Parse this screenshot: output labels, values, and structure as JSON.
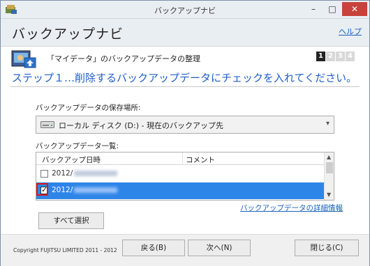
{
  "window": {
    "title": "バックアップナビ",
    "minimize_glyph": "–",
    "maximize_glyph": "□",
    "close_glyph": "✕"
  },
  "header": {
    "title": "バックアップナビ",
    "help_link": "ヘルプ"
  },
  "section": {
    "title": "「マイデータ」のバックアップデータの整理",
    "icon": "backup-photo-icon"
  },
  "steps": [
    "1",
    "2",
    "3",
    "4"
  ],
  "current_step": 1,
  "step_heading": "ステップ１…削除するバックアップデータにチェックを入れてください。",
  "storage": {
    "label": "バックアップデータの保存場所:",
    "selected": "ローカル ディスク (D:) - 現在のバックアップ先",
    "icon": "drive-icon"
  },
  "backup_list": {
    "label": "バックアップデータ一覧:",
    "columns": [
      "バックアップ日時",
      "コメント"
    ],
    "rows": [
      {
        "date_prefix": "2012/",
        "checked": false,
        "selected": false
      },
      {
        "date_prefix": "2012/",
        "checked": true,
        "selected": true
      }
    ]
  },
  "detail_link": "バックアップデータの詳細情報",
  "buttons": {
    "select_all": "すべて選択",
    "back": "戻る(B)",
    "next": "次へ(N)",
    "close": "閉じる(C)"
  },
  "footer": {
    "copyright": "Copyright FUJITSU LIMITED 2011 - 2012"
  },
  "colors": {
    "accent_blue": "#1f5fc6",
    "selection_blue": "#2e85e8",
    "highlight_red": "#e0141b"
  }
}
